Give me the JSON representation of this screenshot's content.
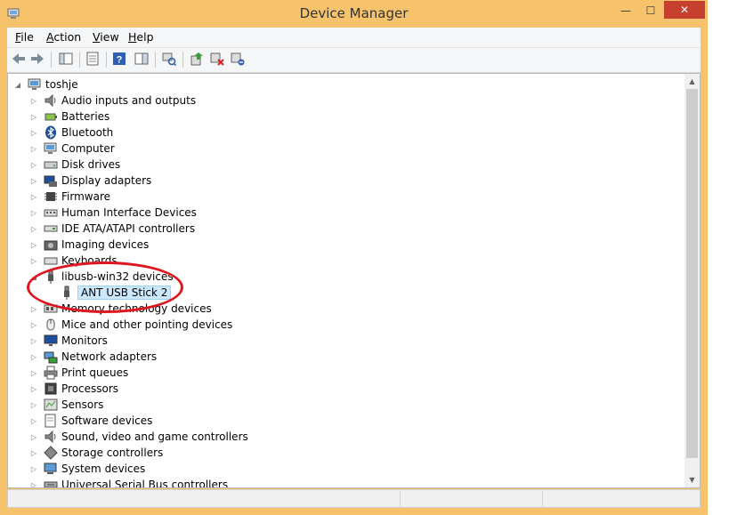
{
  "window": {
    "title": "Device Manager",
    "minimize_icon": "minimize-icon",
    "maximize_icon": "maximize-icon",
    "close_icon": "close-icon",
    "minimize_glyph": "—",
    "maximize_glyph": "☐",
    "close_glyph": "✕"
  },
  "menu": [
    "File",
    "Action",
    "View",
    "Help"
  ],
  "toolbar": {
    "buttons": [
      "back-arrow-icon",
      "forward-arrow-icon",
      "show-hide-console-tree-icon",
      "properties-icon",
      "help-icon",
      "action-pane-icon",
      "scan-hardware-icon",
      "update-driver-icon",
      "disable-device-icon",
      "uninstall-device-icon"
    ]
  },
  "tree": {
    "root": "toshje",
    "categories": [
      {
        "label": "Audio inputs and outputs",
        "icon": "speaker-icon"
      },
      {
        "label": "Batteries",
        "icon": "battery-icon"
      },
      {
        "label": "Bluetooth",
        "icon": "bluetooth-icon"
      },
      {
        "label": "Computer",
        "icon": "computer-icon"
      },
      {
        "label": "Disk drives",
        "icon": "disk-drive-icon"
      },
      {
        "label": "Display adapters",
        "icon": "display-adapter-icon"
      },
      {
        "label": "Firmware",
        "icon": "firmware-icon"
      },
      {
        "label": "Human Interface Devices",
        "icon": "hid-icon"
      },
      {
        "label": "IDE ATA/ATAPI controllers",
        "icon": "ide-controller-icon"
      },
      {
        "label": "Imaging devices",
        "icon": "camera-icon"
      },
      {
        "label": "Keyboards",
        "icon": "keyboard-icon"
      },
      {
        "label": "libusb-win32 devices",
        "icon": "usb-plug-icon",
        "expanded": true,
        "children": [
          {
            "label": "ANT USB Stick 2",
            "icon": "usb-plug-icon",
            "selected": true
          }
        ]
      },
      {
        "label": "Memory technology devices",
        "icon": "memory-icon"
      },
      {
        "label": "Mice and other pointing devices",
        "icon": "mouse-icon"
      },
      {
        "label": "Monitors",
        "icon": "monitor-icon"
      },
      {
        "label": "Network adapters",
        "icon": "network-adapter-icon"
      },
      {
        "label": "Print queues",
        "icon": "printer-icon"
      },
      {
        "label": "Processors",
        "icon": "processor-icon"
      },
      {
        "label": "Sensors",
        "icon": "sensor-icon"
      },
      {
        "label": "Software devices",
        "icon": "software-device-icon"
      },
      {
        "label": "Sound, video and game controllers",
        "icon": "speaker-icon"
      },
      {
        "label": "Storage controllers",
        "icon": "storage-controller-icon"
      },
      {
        "label": "System devices",
        "icon": "system-device-icon"
      },
      {
        "label": "Universal Serial Bus controllers",
        "icon": "usb-controller-icon"
      }
    ]
  },
  "colors": {
    "frame": "#f6c26b",
    "selection": "#cce8ff",
    "annotation": "#e0141e"
  }
}
